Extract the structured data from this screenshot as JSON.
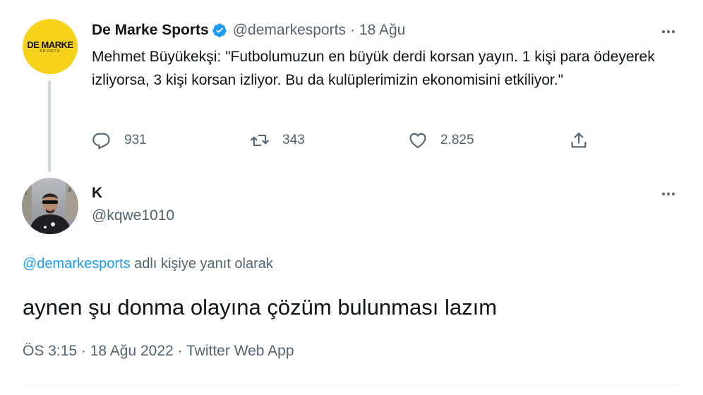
{
  "tweet": {
    "avatar": {
      "logo_main": "DE MARKE",
      "logo_sub": "SPORTS",
      "bg_color": "#f7d21b"
    },
    "author_name": "De Marke Sports",
    "handle": "@demarkesports",
    "separator": "·",
    "date": "18 Ağu",
    "text": "Mehmet Büyükekşi: \"Futbolumuzun en büyük derdi korsan yayın. 1 kişi para ödeyerek izliyorsa, 3 kişi korsan izliyor. Bu da kulüplerimizin ekonomisini etkiliyor.\"",
    "actions": {
      "reply_icon": "reply-icon",
      "reply_count": "931",
      "retweet_icon": "retweet-icon",
      "retweet_count": "343",
      "like_icon": "heart-icon",
      "like_count": "2.825",
      "share_icon": "share-icon"
    }
  },
  "reply": {
    "author_name": "K",
    "handle": "@kqwe1010",
    "replying_to": {
      "handle_link": "@demarkesports",
      "suffix": "adlı kişiye yanıt olarak"
    },
    "text": "aynen şu donma olayına çözüm bulunması lazım",
    "meta": {
      "time": "ÖS 3:15",
      "sep1": "·",
      "date": "18 Ağu 2022",
      "sep2": "·",
      "source": "Twitter Web App"
    }
  },
  "colors": {
    "link": "#1d9bf0",
    "muted": "#536471",
    "text": "#0f1419",
    "verified": "#1d9bf0"
  }
}
